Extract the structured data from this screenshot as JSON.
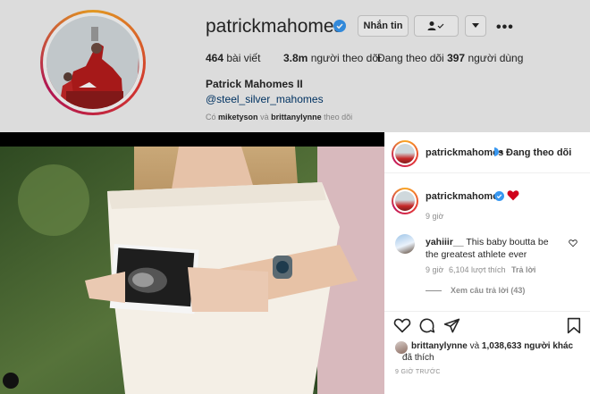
{
  "profile": {
    "username": "patrickmahomes",
    "message_button": "Nhắn tin",
    "dots": "•••",
    "stats": {
      "posts": "464",
      "posts_label": "bài viết",
      "followers": "3.8m",
      "followers_label": "người theo dõi",
      "following_prefix": "Đang theo dõi",
      "following": "397",
      "following_label": "người dùng"
    },
    "full_name": "Patrick Mahomes II",
    "handle": "@steel_silver_mahomes",
    "followed_by": {
      "prefix": "Có",
      "user1": "miketyson",
      "joiner": "và",
      "user2": "brittanylynne",
      "suffix": "theo dõi"
    }
  },
  "post": {
    "header": {
      "username": "patrickmahomes",
      "dot": "•",
      "following_label": "Đang theo dõi"
    },
    "caption": {
      "username": "patrickmahomes",
      "time": "9 giờ"
    },
    "comment": {
      "username": "yahiiir__",
      "text": "This baby boutta be the greatest athlete ever",
      "time": "9 giờ",
      "likes": "6,104 lượt thích",
      "reply": "Trả lời",
      "view_replies": "Xem câu trả lời (43)"
    },
    "likes": {
      "user": "brittanylynne",
      "joiner": "và",
      "count": "1,038,633",
      "others": "người khác",
      "liked": "đã thích"
    },
    "timestamp": "9 GIỜ TRƯỚC"
  },
  "colors": {
    "verified": "#3897f0",
    "heart": "#ed4956",
    "link": "#00376b",
    "muted": "#8e8e8e"
  },
  "icons": [
    "verified-badge-icon",
    "person-check-icon",
    "chevron-down-icon",
    "heart-icon",
    "comment-icon",
    "share-icon",
    "bookmark-icon"
  ]
}
